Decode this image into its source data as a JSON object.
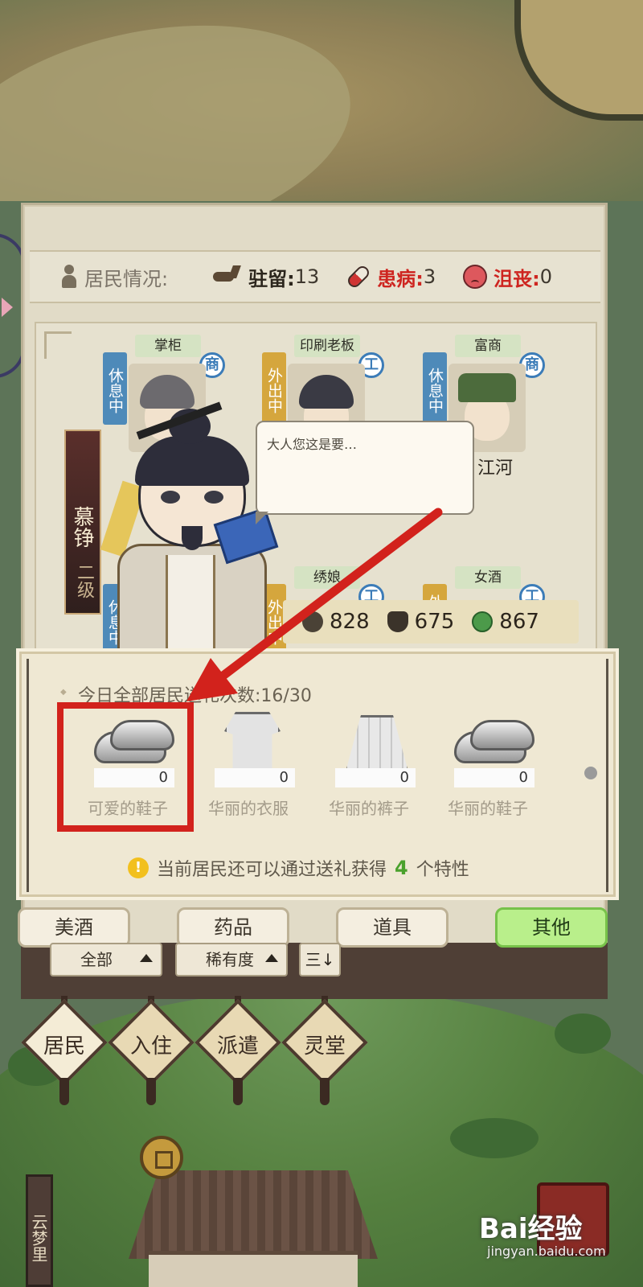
{
  "status": {
    "residents_label": "居民情况:",
    "stay_label": "驻留:",
    "stay_value": "13",
    "sick_label": "患病:",
    "sick_value": "3",
    "depressed_label": "沮丧:",
    "depressed_value": "0"
  },
  "residents": [
    {
      "role": "掌柜",
      "state": "休息中",
      "badge": "商",
      "name": ""
    },
    {
      "role": "印刷老板",
      "state": "外出中",
      "badge": "工",
      "name": ""
    },
    {
      "role": "富商",
      "state": "休息中",
      "badge": "商",
      "name": "江河"
    },
    {
      "role": "",
      "state": "休息中",
      "badge": "",
      "name": ""
    },
    {
      "role": "绣娘",
      "state": "外出中",
      "badge": "工",
      "name": ""
    },
    {
      "role": "女酒",
      "state": "外",
      "badge": "工",
      "name": ""
    }
  ],
  "selected_resident": {
    "name": "慕铮",
    "level": "二级",
    "speech": "大人您这是要…"
  },
  "stats": {
    "attr1": "828",
    "attr2": "675",
    "attr3": "867"
  },
  "gifts": {
    "count_text": "今日全部居民送礼次数:16/30",
    "items": [
      {
        "name": "可爱的鞋子",
        "qty": "0",
        "icon": "shoe-icon"
      },
      {
        "name": "华丽的衣服",
        "qty": "0",
        "icon": "robe-icon"
      },
      {
        "name": "华丽的裤子",
        "qty": "0",
        "icon": "skirt-icon"
      },
      {
        "name": "华丽的鞋子",
        "qty": "0",
        "icon": "shoe-icon"
      }
    ],
    "hint_prefix": "当前居民还可以通过送礼获得",
    "hint_number": "4",
    "hint_suffix": "个特性"
  },
  "categories": [
    {
      "label": "美酒",
      "active": false
    },
    {
      "label": "药品",
      "active": false
    },
    {
      "label": "道具",
      "active": false
    },
    {
      "label": "其他",
      "active": true
    }
  ],
  "filters": {
    "all": "全部",
    "rarity": "稀有度",
    "sort_icon": "三↓"
  },
  "nav": [
    {
      "label": "居民",
      "active": true
    },
    {
      "label": "入住",
      "active": false
    },
    {
      "label": "派遣",
      "active": false
    },
    {
      "label": "灵堂",
      "active": false
    }
  ],
  "map_sign": "云梦里",
  "watermark": {
    "brand": "Bai经验",
    "url": "jingyan.baidu.com"
  },
  "colors": {
    "accent_red": "#d2221c",
    "active_green": "#b9ef8b",
    "hint_green": "#4aa12c"
  }
}
